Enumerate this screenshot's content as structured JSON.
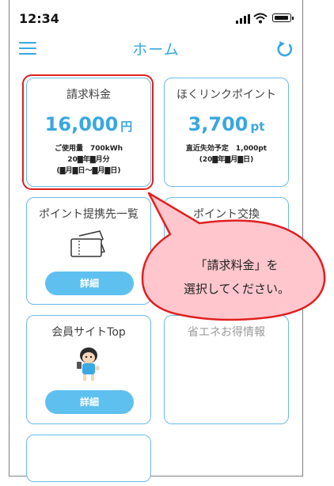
{
  "status": {
    "time": "12:34"
  },
  "appbar": {
    "title": "ホーム"
  },
  "cards": {
    "bill": {
      "title": "請求料金",
      "amount": "16,000",
      "unit": "円",
      "line1": "ご使用量　700kWh",
      "line2": "20▇年▇月分",
      "line3": "(▇月▇日〜▇月▇日)"
    },
    "points": {
      "title": "ほくリンクポイント",
      "amount": "3,700",
      "unit": "pt",
      "line1": "直近失効予定　1,000pt",
      "line2": "(20▇年▇月▇日)"
    },
    "partners": {
      "title": "ポイント提携先一覧",
      "button": "詳細"
    },
    "exchange": {
      "title": "ポイント交換"
    },
    "member": {
      "title": "会員サイトTop",
      "button": "詳細"
    },
    "energy": {
      "title": "省エネお得情報"
    }
  },
  "callout": {
    "line1": "「請求料金」を",
    "line2": "選択してください。"
  },
  "colors": {
    "accent": "#3aa7e0",
    "button": "#5ec0ef",
    "highlight": "#e02020",
    "callout_fill": "#ffc6cd"
  },
  "icons": [
    "menu-icon",
    "signal-icon",
    "wifi-icon",
    "battery-icon",
    "reload-icon",
    "ticket-icon",
    "mascot-icon"
  ]
}
